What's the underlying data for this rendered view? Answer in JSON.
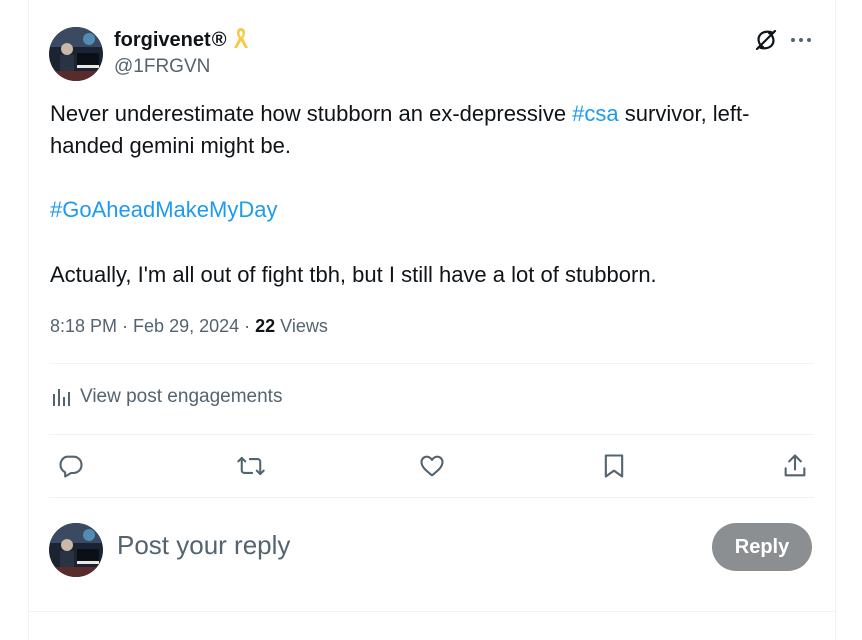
{
  "post": {
    "author": {
      "display_name": "forgivenet",
      "registered_mark": "®",
      "handle": "@1FRGVN",
      "avatar": "avatar-pianist",
      "badge": "ribbon-icon"
    },
    "text": {
      "line1_pre": "Never underestimate how stubborn an ex-depressive ",
      "hashtag1": "#csa",
      "line1_post": " survivor, left-handed gemini might be.",
      "hashtag2": "#GoAheadMakeMyDay",
      "line3": "Actually, I'm all out of fight tbh, but I still have a lot of stubborn."
    },
    "meta": {
      "time": "8:18 PM",
      "sep1": " · ",
      "date": "Feb 29, 2024",
      "sep2": " · ",
      "views_count": "22",
      "views_label": " Views"
    },
    "engagements_link": "View post engagements",
    "actions": [
      "reply-icon",
      "repost-icon",
      "like-icon",
      "bookmark-icon",
      "share-icon"
    ],
    "top_icons": [
      "grok-icon",
      "more-icon"
    ]
  },
  "reply": {
    "placeholder": "Post your reply",
    "button_label": "Reply"
  },
  "colors": {
    "text": "#0f1419",
    "secondary": "#536471",
    "link": "#1d9bf0",
    "reply_button": "#8b8f92",
    "divider": "#eff3f4",
    "ribbon": "#f7c948"
  }
}
